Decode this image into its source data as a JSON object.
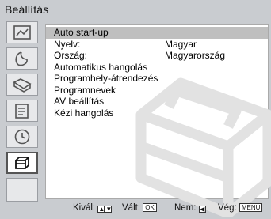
{
  "title": "Beállítás",
  "tabs": [
    {
      "icon": "picture-icon"
    },
    {
      "icon": "sound-icon"
    },
    {
      "icon": "screen-icon"
    },
    {
      "icon": "features-icon"
    },
    {
      "icon": "timer-icon"
    },
    {
      "icon": "toolbox-icon",
      "active": true
    },
    {
      "icon": "blank-icon"
    }
  ],
  "menu": [
    {
      "label": "Auto start-up",
      "value": "",
      "selected": true
    },
    {
      "label": "Nyelv:",
      "value": "Magyar"
    },
    {
      "label": "Ország:",
      "value": "Magyarország"
    },
    {
      "label": "Automatikus hangolás",
      "value": ""
    },
    {
      "label": "Programhely-átrendezés",
      "value": ""
    },
    {
      "label": "Programnevek",
      "value": ""
    },
    {
      "label": "AV beállítás",
      "value": ""
    },
    {
      "label": "Kézi hangolás",
      "value": ""
    }
  ],
  "footer": {
    "select_label": "Kivál:",
    "change_label": "Vált:",
    "ok_key": "OK",
    "back_label": "Nem:",
    "exit_label": "Vég:",
    "menu_key": "MENU"
  }
}
